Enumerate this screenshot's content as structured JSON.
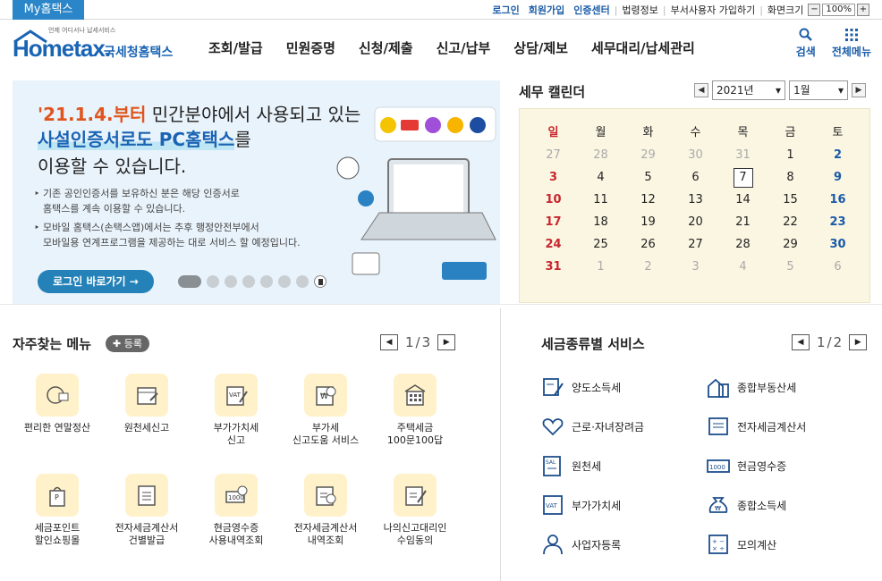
{
  "topbar": {
    "myhometax": "My홈택스",
    "links": [
      "로그인",
      "회원가입",
      "인증센터"
    ],
    "plain": [
      "법령정보",
      "부서사용자 가입하기",
      "화면크기"
    ],
    "zoom_minus": "−",
    "zoom_value": "100%",
    "zoom_plus": "+"
  },
  "logo": {
    "small": "언제 어디서나 납세서비스",
    "main": "Hometax.",
    "kr": "국세청홈택스"
  },
  "gnb": [
    "조회/발급",
    "민원증명",
    "신청/제출",
    "신고/납부",
    "상담/제보",
    "세무대리/납세관리"
  ],
  "header_buttons": {
    "search": "검색",
    "all_menu": "전체메뉴"
  },
  "banner": {
    "line1_em": "'21.1.4.부터",
    "line1_rest": " 민간분야에서 사용되고 있는",
    "line2_hl": "사설인증서로도 PC홈택스",
    "line2_rest": "를",
    "line3": "이용할 수 있습니다.",
    "bullet1_a": "기존 공인인증서를 보유하신 분은 해당 인증서로",
    "bullet1_b": "홈택스를 계속 이용할 수 있습니다.",
    "bullet2_a": "모바일 홈택스(손택스앱)에서는 추후 행정안전부에서",
    "bullet2_b": "모바일용 연계프로그램을 제공하는 대로 서비스 할 예정입니다.",
    "login_button": "로그인 바로가기 →",
    "slide_count": 8,
    "active_slide": 1
  },
  "calendar": {
    "title": "세무 캘린더",
    "year": "2021년",
    "month": "1월",
    "weekdays": [
      "일",
      "월",
      "화",
      "수",
      "목",
      "금",
      "토"
    ],
    "days": [
      [
        "27",
        "28",
        "29",
        "30",
        "31",
        "1",
        "2"
      ],
      [
        "3",
        "4",
        "5",
        "6",
        "7",
        "8",
        "9"
      ],
      [
        "10",
        "11",
        "12",
        "13",
        "14",
        "15",
        "16"
      ],
      [
        "17",
        "18",
        "19",
        "20",
        "21",
        "22",
        "23"
      ],
      [
        "24",
        "25",
        "26",
        "27",
        "28",
        "29",
        "30"
      ],
      [
        "31",
        "1",
        "2",
        "3",
        "4",
        "5",
        "6"
      ]
    ],
    "today": "7"
  },
  "favorites": {
    "title": "자주찾는 메뉴",
    "register": "✚ 등록",
    "page_current": "1",
    "page_total": "3",
    "items": [
      {
        "l1": "편리한 연말정산",
        "l2": ""
      },
      {
        "l1": "원천세신고",
        "l2": ""
      },
      {
        "l1": "부가가치세",
        "l2": "신고"
      },
      {
        "l1": "부가세",
        "l2": "신고도움 서비스"
      },
      {
        "l1": "주택세금",
        "l2": "100문100답"
      },
      {
        "l1": "세금포인트",
        "l2": "할인쇼핑몰"
      },
      {
        "l1": "전자세금계산서",
        "l2": "건별발급"
      },
      {
        "l1": "현금영수증",
        "l2": "사용내역조회"
      },
      {
        "l1": "전자세금계산서",
        "l2": "내역조회"
      },
      {
        "l1": "나의신고대리인",
        "l2": "수임동의"
      }
    ]
  },
  "tax_services": {
    "title": "세금종류별 서비스",
    "page_current": "1",
    "page_total": "2",
    "items": [
      "양도소득세",
      "종합부동산세",
      "근로·자녀장려금",
      "전자세금계산서",
      "원천세",
      "현금영수증",
      "부가가치세",
      "종합소득세",
      "사업자등록",
      "모의계산"
    ]
  }
}
